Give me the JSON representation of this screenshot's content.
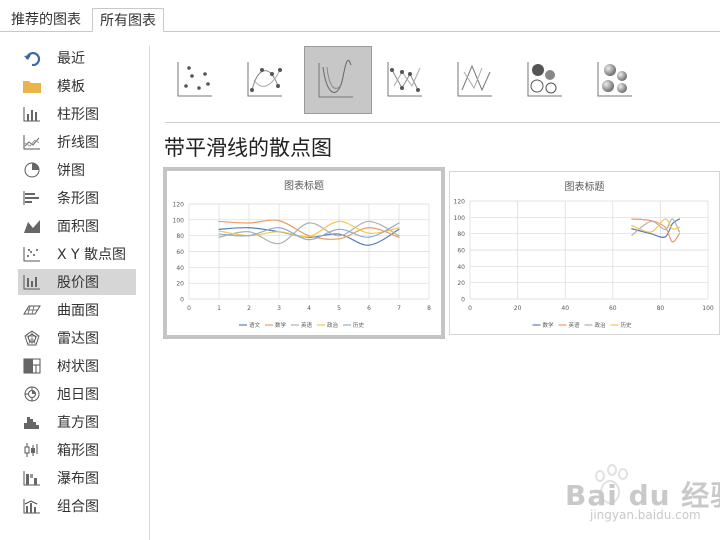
{
  "tabs": [
    {
      "label": "推荐的图表",
      "selected": false
    },
    {
      "label": "所有图表",
      "selected": true
    }
  ],
  "sidebar": {
    "selected_index": 8,
    "items": [
      {
        "label": "最近",
        "icon": "recent-icon"
      },
      {
        "label": "模板",
        "icon": "folder-icon"
      },
      {
        "label": "柱形图",
        "icon": "column-chart-icon"
      },
      {
        "label": "折线图",
        "icon": "line-chart-icon"
      },
      {
        "label": "饼图",
        "icon": "pie-chart-icon"
      },
      {
        "label": "条形图",
        "icon": "bar-chart-icon"
      },
      {
        "label": "面积图",
        "icon": "area-chart-icon"
      },
      {
        "label": "X Y 散点图",
        "icon": "scatter-chart-icon"
      },
      {
        "label": "股价图",
        "icon": "stock-chart-icon"
      },
      {
        "label": "曲面图",
        "icon": "surface-chart-icon"
      },
      {
        "label": "雷达图",
        "icon": "radar-chart-icon"
      },
      {
        "label": "树状图",
        "icon": "treemap-icon"
      },
      {
        "label": "旭日图",
        "icon": "sunburst-icon"
      },
      {
        "label": "直方图",
        "icon": "histogram-icon"
      },
      {
        "label": "箱形图",
        "icon": "box-whisker-icon"
      },
      {
        "label": "瀑布图",
        "icon": "waterfall-icon"
      },
      {
        "label": "组合图",
        "icon": "combo-chart-icon"
      }
    ]
  },
  "subtypes": {
    "selected_index": 2,
    "items": [
      "scatter-icon",
      "scatter-smooth-markers-icon",
      "scatter-smooth-lines-icon",
      "scatter-straight-markers-icon",
      "scatter-straight-lines-icon",
      "bubble-icon",
      "bubble-3d-icon"
    ]
  },
  "section_title": "带平滑线的散点图",
  "colors": {
    "blue": "#5b7fb5",
    "orange": "#ed9b62",
    "gray": "#b0b0b0",
    "yellow": "#f2c94c",
    "steel": "#8faecf",
    "grid": "#d9d9d9",
    "selected_bg": "#c7c7c7"
  },
  "chart_data": [
    {
      "type": "scatter",
      "title": "图表标题",
      "xlim": [
        0,
        8
      ],
      "ylim": [
        0,
        120
      ],
      "x_ticks": [
        "0",
        "1",
        "2",
        "3",
        "4",
        "5",
        "6",
        "7",
        "8"
      ],
      "y_ticks": [
        "0",
        "20",
        "40",
        "60",
        "80",
        "100",
        "120"
      ],
      "grid": true,
      "legend": "bottom",
      "x": [
        1,
        2,
        3,
        4,
        5,
        6,
        7
      ],
      "series": [
        {
          "name": "语文",
          "color": "#5b7fb5",
          "values": [
            88,
            90,
            85,
            78,
            82,
            68,
            88
          ]
        },
        {
          "name": "数学",
          "color": "#ed9b62",
          "values": [
            98,
            96,
            99,
            80,
            76,
            90,
            78
          ]
        },
        {
          "name": "英语",
          "color": "#b0b0b0",
          "values": [
            78,
            85,
            70,
            96,
            80,
            98,
            80
          ]
        },
        {
          "name": "政治",
          "color": "#f2c94c",
          "values": [
            86,
            80,
            85,
            79,
            98,
            83,
            90
          ]
        },
        {
          "name": "历史",
          "color": "#8faecf",
          "values": [
            82,
            80,
            90,
            75,
            88,
            78,
            96
          ]
        }
      ]
    },
    {
      "type": "scatter",
      "title": "图表标题",
      "xlim": [
        0,
        100
      ],
      "ylim": [
        0,
        120
      ],
      "x_ticks": [
        "0",
        "20",
        "40",
        "60",
        "80",
        "100"
      ],
      "y_ticks": [
        "0",
        "20",
        "40",
        "60",
        "80",
        "100",
        "120"
      ],
      "grid": true,
      "legend": "bottom",
      "x": [
        68,
        76,
        82,
        85,
        88
      ],
      "series": [
        {
          "name": "数学",
          "color": "#5b7fb5",
          "values": [
            86,
            80,
            76,
            92,
            98
          ]
        },
        {
          "name": "英语",
          "color": "#ed9b62",
          "values": [
            98,
            96,
            88,
            70,
            80
          ]
        },
        {
          "name": "政治",
          "color": "#b0b0b0",
          "values": [
            78,
            95,
            85,
            98,
            82
          ]
        },
        {
          "name": "历史",
          "color": "#f2c94c",
          "values": [
            90,
            82,
            98,
            86,
            88
          ]
        }
      ]
    }
  ],
  "watermark": {
    "text": "Bai du 经验",
    "sub": "jingyan.baidu.com"
  }
}
